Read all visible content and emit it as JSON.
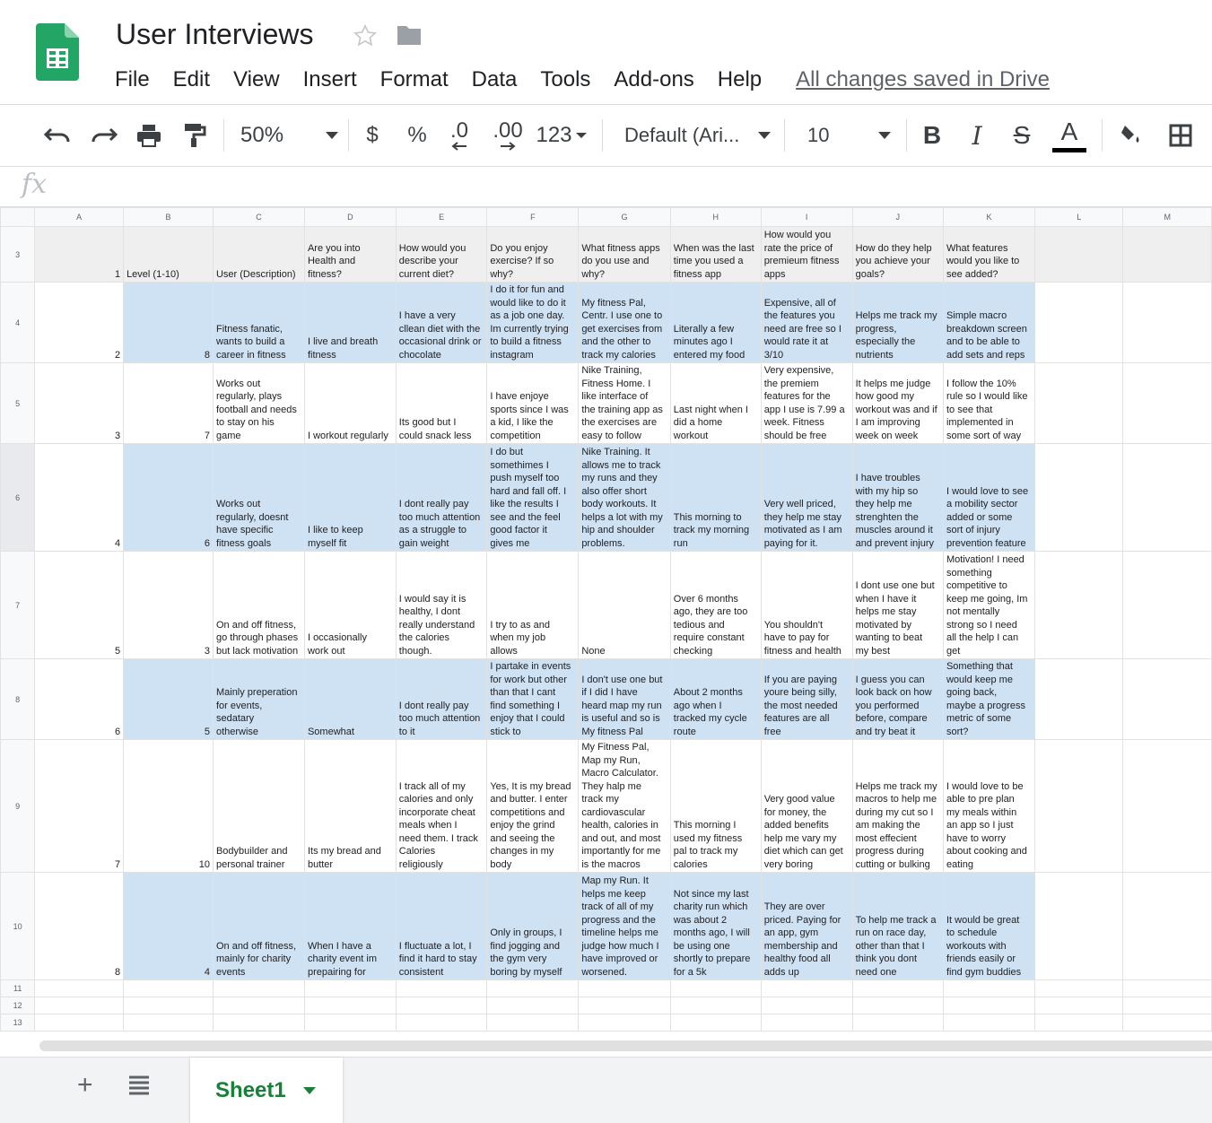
{
  "app": {
    "title": "User Interviews",
    "saved_status": "All changes saved in Drive",
    "menu": [
      "File",
      "Edit",
      "View",
      "Insert",
      "Format",
      "Data",
      "Tools",
      "Add-ons",
      "Help"
    ]
  },
  "toolbar": {
    "zoom": "50%",
    "currency": "$",
    "percent": "%",
    "decrease_decimal": ".0",
    "increase_decimal": ".00",
    "more_formats": "123",
    "font": "Default (Ari...",
    "font_size": "10",
    "bold": "B",
    "italic": "I",
    "strike": "S",
    "text_color": "A"
  },
  "formula_bar": {
    "fx": "fx",
    "value": ""
  },
  "colors": {
    "brand_green": "#188038",
    "header_row_bg": "#efefef",
    "band_blue": "#cfe2f3"
  },
  "grid": {
    "columns": [
      "A",
      "B",
      "C",
      "D",
      "E",
      "F",
      "G",
      "H",
      "I",
      "J",
      "K",
      "L",
      "M"
    ],
    "rows": [
      {
        "num": "3",
        "cells": [
          "1",
          "Level (1-10)",
          "User (Description)",
          "Are you into\nHealth and\nfitness?",
          "How would you\ndescribe your\ncurrent diet?",
          "Do you enjoy\nexercise? If so\nwhy?",
          "What fitness apps\ndo you use and\nwhy?",
          "When was the last\ntime you used a\nfitness app",
          "How would you\nrate the price of\npremieum fitness\napps",
          "How do they help\nyou achieve your\ngoals?",
          "What features\nwould you like to\nsee added?",
          "",
          ""
        ]
      },
      {
        "num": "4",
        "cells": [
          "2",
          "8",
          "Fitness fanatic,\nwants to build a\ncareer in fitness",
          "I live and breath\nfitness",
          "I have a very\ncllean diet with the\noccasional drink or\nchocolate",
          "I do it for fun and\nwould like to do it\nas a job one day.\nIm currently trying\nto build a fitness\ninstagram",
          "My fitness Pal,\nCentr. I use one to\nget exercises from\nand the other to\ntrack my calories",
          "Literally a few\nminutes ago I\nentered my food",
          "Expensive, all of\nthe features you\nneed are free so I\nwould rate it at\n3/10",
          "Helps me track my\nprogress,\nespecially the\nnutrients",
          "Simple macro\nbreakdown screen\nand to be able to\nadd sets and reps",
          "",
          ""
        ]
      },
      {
        "num": "5",
        "cells": [
          "3",
          "7",
          "Works out\nregularly, plays\nfootball and needs\nto stay on his\ngame",
          "I workout regularly",
          "Its good but I\ncould snack less",
          "I have enjoye\nsports since I was\na kid, I like the\ncompetition",
          "Nike Training,\nFitness Home. I\nlike interface of\nthe training app as\nthe exercises are\neasy to follow",
          "Last night when I\ndid a home\nworkout",
          "Very expensive,\nthe premiem\nfeatures for the\napp I use is 7.99 a\nweek. Fitness\nshould be free",
          "It helps me judge\nhow good my\nworkout was and if\nI am improving\nweek on week",
          "I follow the 10%\nrule so I would like\nto see that\nimplemented in\nsome sort of way",
          "",
          ""
        ]
      },
      {
        "num": "6",
        "cells": [
          "4",
          "6",
          "Works out\nregularly, doesnt\nhave specific\nfitness goals",
          "I like to keep\nmyself fit",
          "I dont really pay\ntoo much attention\nas a struggle to\ngain weight",
          "I do but\nsomethimes I\npush myself too\nhard and fall off. I\nlike the results I\nsee and the feel\ngood factor it\ngives me",
          "Nike Training. It\nallows me to track\nmy runs and they\nalso offer short\nbody workouts. It\nhelps a lot with my\nhip and shoulder\nproblems.",
          "This morning to\ntrack my morning\nrun",
          "Very well priced,\nthey help me stay\nmotivated as I am\npaying for it.",
          "I have troubles\nwith my hip so\nthey help me\nstrenghten the\nmuscles around it\nand prevent injury",
          "I would love to see\na mobility sector\nadded or some\nsort of injury\nprevention feature",
          "",
          ""
        ]
      },
      {
        "num": "7",
        "cells": [
          "5",
          "3",
          "On and off fitness,\ngo through phases\nbut lack motivation",
          "I occasionally\nwork out",
          "I would say it is\nhealthy, I dont\nreally understand\nthe calories\nthough.",
          "I try to as and\nwhen my job\nallows",
          "None",
          "Over 6 months\nago, they are too\ntedious and\nrequire constant\nchecking",
          "You shouldn't\nhave to pay for\nfitness and health",
          "I dont use one but\nwhen I have it\nhelps me stay\nmotivated by\nwanting to beat\nmy best",
          "Motivation! I need\nsomething\ncompetitive to\nkeep me going, Im\nnot mentally\nstrong so I need\nall the help I can\nget",
          "",
          ""
        ]
      },
      {
        "num": "8",
        "cells": [
          "6",
          "5",
          "Mainly preperation\nfor events,\nsedatary\notherwise",
          "Somewhat",
          "I dont really pay\ntoo much attention\nto it",
          "I partake in events\nfor work but other\nthan that I cant\nfind something I\nenjoy that I could\nstick to",
          "I don't use one but\nif I did I have\nheard map my run\nis useful and so is\nMy fitness Pal",
          "About 2 months\nago when I\ntracked my cycle\nroute",
          "If you are paying\nyoure being silly,\nthe most needed\nfeatures are all\nfree",
          "I guess you can\nlook back on how\nyou performed\nbefore, compare\nand try beat it",
          "Something that\nwould keep me\ngoing back,\nmaybe a progress\nmetric of some\nsort?",
          "",
          ""
        ]
      },
      {
        "num": "9",
        "cells": [
          "7",
          "10",
          "Bodybuilder and\npersonal trainer",
          "Its my bread and\nbutter",
          "I track all of my\ncalories and only\nincorporate cheat\nmeals when I\nneed them. I track\nCalories\nreligiously",
          "Yes, It is my bread\nand butter. I enter\ncompetitions and\nenjoy the grind\nand seeing the\nchanges in my\nbody",
          "My Fitness Pal,\nMap my Run,\nMacro Calculator.\nThey halp me\ntrack my\ncardiovascular\nhealth, calories in\nand out, and most\nimportantly for me\nis the macros",
          "This morning I\nused my fitness\npal to track my\ncalories",
          "Very good value\nfor money, the\nadded benefits\nhelp me vary my\ndiet which can get\nvery boring",
          "Helps me track my\nmacros to help me\nduring my cut so I\nam making the\nmost effecient\nprogress during\ncutting or bulking",
          "I would love to be\nable to pre plan\nmy meals within\nan app so I just\nhave to worry\nabout cooking and\neating",
          "",
          ""
        ]
      },
      {
        "num": "10",
        "cells": [
          "8",
          "4",
          "On and off fitness,\nmainly for charity\nevents",
          "When I have a\ncharity event im\nprepairing for",
          "I fluctuate a lot, I\nfind it hard to stay\nconsistent",
          "Only in groups, I\nfind jogging and\nthe gym very\nboring by myself",
          "Map my Run. It\nhelps me keep\ntrack of all of my\nprogress and the\ntimeline helps me\njudge how much I\nhave improved or\nworsened.",
          "Not since my last\ncharity run which\nwas about 2\nmonths ago, I will\nbe using one\nshortly to prepare\nfor a 5k",
          "They are over\npriced. Paying for\nan app, gym\nmembership and\nhealthy food all\nadds up",
          "To help me track a\nrun on race day,\nother than that I\nthink you dont\nneed one",
          "It would be great\nto schedule\nworkouts with\nfriends easily or\nfind gym buddies",
          "",
          ""
        ]
      },
      {
        "num": "11",
        "cells": [
          "",
          "",
          "",
          "",
          "",
          "",
          "",
          "",
          "",
          "",
          "",
          "",
          ""
        ]
      },
      {
        "num": "12",
        "cells": [
          "",
          "",
          "",
          "",
          "",
          "",
          "",
          "",
          "",
          "",
          "",
          "",
          ""
        ]
      },
      {
        "num": "13",
        "cells": [
          "",
          "",
          "",
          "",
          "",
          "",
          "",
          "",
          "",
          "",
          "",
          "",
          ""
        ]
      }
    ]
  },
  "sheets": {
    "active": "Sheet1",
    "add_label": "+"
  }
}
